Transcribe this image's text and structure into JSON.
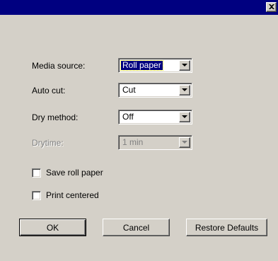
{
  "window": {
    "title": "",
    "close_icon": "close-icon"
  },
  "fields": {
    "media_source": {
      "label": "Media source:",
      "value": "Roll paper",
      "state": "focused"
    },
    "auto_cut": {
      "label": "Auto cut:",
      "value": "Cut",
      "state": "enabled"
    },
    "dry_method": {
      "label": "Dry method:",
      "value": "Off",
      "state": "enabled"
    },
    "drytime": {
      "label": "Drytime:",
      "value": "1 min",
      "state": "disabled"
    }
  },
  "checkboxes": {
    "save_roll_paper": {
      "label": "Save roll paper",
      "checked": false
    },
    "print_centered": {
      "label": "Print centered",
      "checked": false
    }
  },
  "buttons": {
    "ok": "OK",
    "cancel": "Cancel",
    "restore_defaults": "Restore Defaults"
  },
  "colors": {
    "titlebar": "#000080",
    "face": "#d4d0c8",
    "selection": "#000080",
    "disabled_text": "#808080"
  }
}
